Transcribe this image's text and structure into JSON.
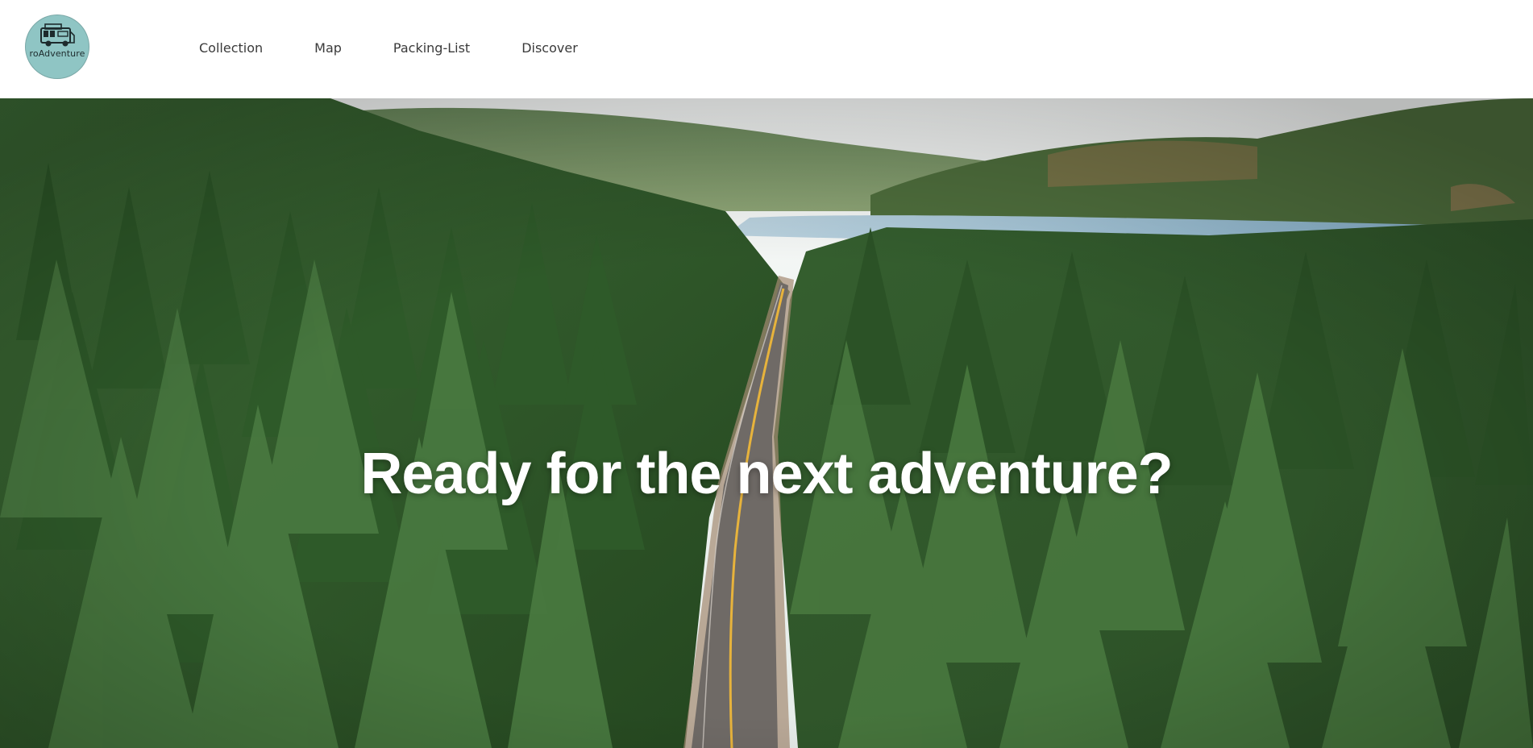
{
  "logo": {
    "text": "roAdventure",
    "icon": "camper-van-icon",
    "bg_color": "#8fc5c4"
  },
  "nav": {
    "items": [
      {
        "label": "Collection"
      },
      {
        "label": "Map"
      },
      {
        "label": "Packing-List"
      },
      {
        "label": "Discover"
      }
    ]
  },
  "hero": {
    "headline": "Ready for the next adventure?",
    "image": "aerial-forest-road",
    "colors": {
      "sky": "#f4f6f4",
      "forest": "#2f5a2c",
      "lake": "#9cc3d9",
      "road": "#6f6a66",
      "center_line": "#e7b33c"
    }
  }
}
